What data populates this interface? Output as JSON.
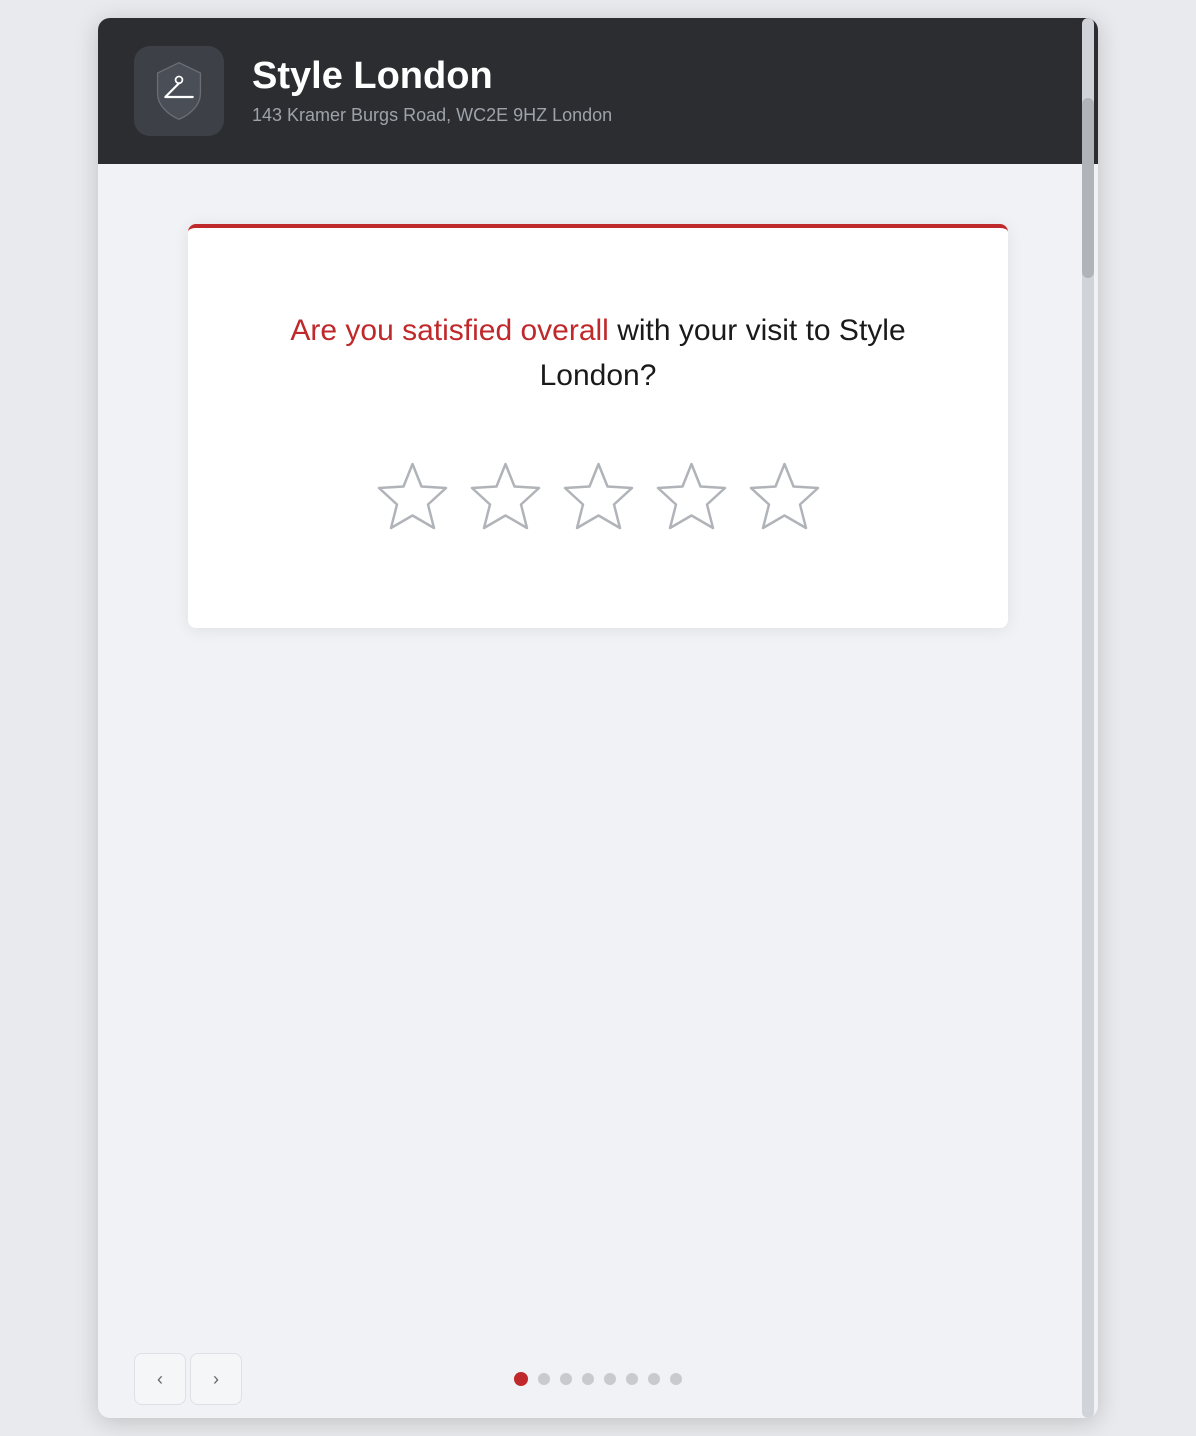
{
  "header": {
    "business_name": "Style London",
    "address": "143 Kramer Burgs Road, WC2E 9HZ London"
  },
  "survey": {
    "question_highlight": "Are you satisfied overall",
    "question_rest": " with your visit to Style London?",
    "stars_count": 5
  },
  "navigation": {
    "prev_label": "‹",
    "next_label": "›",
    "dots_count": 8,
    "active_dot": 0
  },
  "colors": {
    "accent": "#c0292b",
    "header_bg": "#2b2d31",
    "star_stroke": "#b0b3b8"
  }
}
